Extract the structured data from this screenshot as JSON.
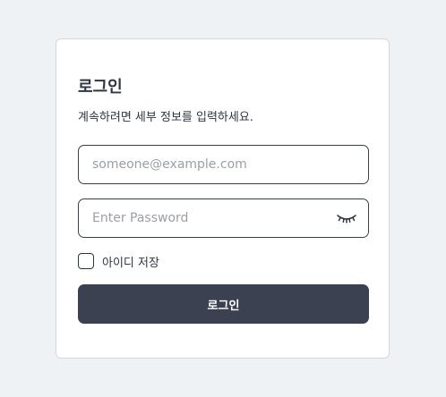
{
  "login": {
    "title": "로그인",
    "subtitle": "계속하려면 세부 정보를 입력하세요.",
    "email_placeholder": "someone@example.com",
    "password_placeholder": "Enter Password",
    "password_toggle_icon": "eye-closed-icon",
    "remember_label": "아이디 저장",
    "remember_checked": false,
    "submit_label": "로그인"
  },
  "colors": {
    "background": "#eff2f4",
    "card": "#ffffff",
    "text": "#2f3542",
    "button": "#3b4150",
    "border": "#3a404d"
  }
}
